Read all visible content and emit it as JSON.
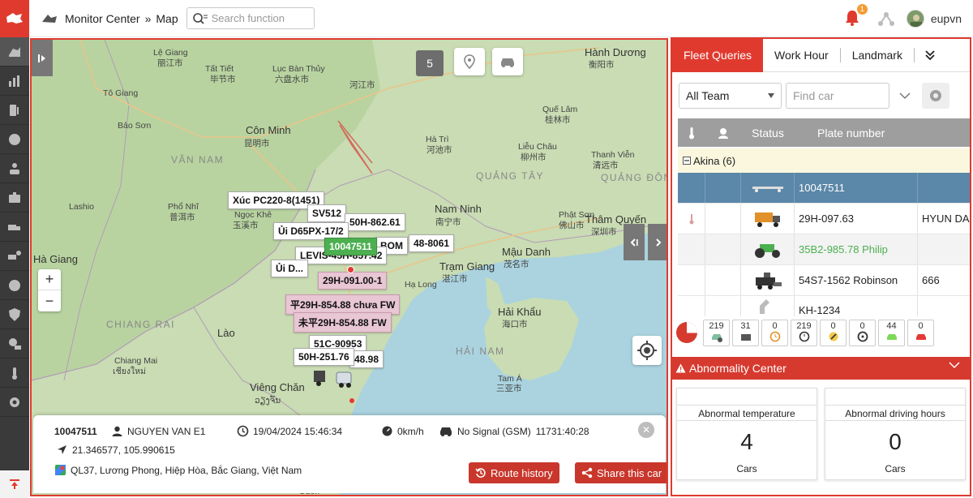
{
  "header": {
    "breadcrumb_section": "Monitor Center",
    "breadcrumb_sep": "»",
    "breadcrumb_page": "Map",
    "search_placeholder": "Search function",
    "notification_count": "1",
    "username": "eupvn"
  },
  "map": {
    "cluster_count": "5",
    "zoom_in": "+",
    "zoom_out": "−",
    "places": [
      {
        "text": "Hà Giang",
        "cls": "big"
      },
      {
        "text": "河江市",
        "cls": ""
      },
      {
        "text": "Hành Dương",
        "cls": "big"
      },
      {
        "text": "衡阳市",
        "cls": ""
      },
      {
        "text": "Lệ Giang",
        "cls": ""
      },
      {
        "text": "丽江市",
        "cls": ""
      },
      {
        "text": "Tất Tiết",
        "cls": ""
      },
      {
        "text": "毕节市",
        "cls": ""
      },
      {
        "text": "Lục Bàn Thủy",
        "cls": ""
      },
      {
        "text": "六盘水市",
        "cls": ""
      },
      {
        "text": "Côn Minh",
        "cls": "big"
      },
      {
        "text": "昆明市",
        "cls": ""
      },
      {
        "text": "VÂN NAM",
        "cls": "region"
      },
      {
        "text": "QUẢNG TÂY",
        "cls": "region"
      },
      {
        "text": "QUẢNG ĐÔNG",
        "cls": "region"
      },
      {
        "text": "Nam Ninh",
        "cls": "big"
      },
      {
        "text": "南宁市",
        "cls": ""
      },
      {
        "text": "Thâm Quyến",
        "cls": "big"
      },
      {
        "text": "深圳市",
        "cls": ""
      },
      {
        "text": "Mậu Danh",
        "cls": "big"
      },
      {
        "text": "茂名市",
        "cls": ""
      },
      {
        "text": "Trạm Giang",
        "cls": "big"
      },
      {
        "text": "湛江市",
        "cls": ""
      },
      {
        "text": "Hải Khẩu",
        "cls": "big"
      },
      {
        "text": "海口市",
        "cls": ""
      },
      {
        "text": "HẢI NAM",
        "cls": "region"
      },
      {
        "text": "Tam Á",
        "cls": ""
      },
      {
        "text": "三亚市",
        "cls": ""
      },
      {
        "text": "Lào",
        "cls": "big"
      },
      {
        "text": "Viêng Chăn",
        "cls": "big"
      },
      {
        "text": "ວຽງຈັນ",
        "cls": ""
      },
      {
        "text": "CHIANG RAI",
        "cls": "region"
      },
      {
        "text": "Chiang Mai",
        "cls": ""
      },
      {
        "text": "เชียงใหม่",
        "cls": ""
      },
      {
        "text": "Lashio",
        "cls": ""
      },
      {
        "text": "Tô Giang",
        "cls": ""
      },
      {
        "text": "Bảo Sơn",
        "cls": ""
      },
      {
        "text": "Liễu Châu",
        "cls": ""
      },
      {
        "text": "柳州市",
        "cls": ""
      },
      {
        "text": "Quế Lâm",
        "cls": ""
      },
      {
        "text": "桂林市",
        "cls": ""
      },
      {
        "text": "Hà Trì",
        "cls": ""
      },
      {
        "text": "河池市",
        "cls": ""
      },
      {
        "text": "Ngọc Khê",
        "cls": ""
      },
      {
        "text": "玉溪市",
        "cls": ""
      },
      {
        "text": "Phổ Nhĩ",
        "cls": ""
      },
      {
        "text": "普洱市",
        "cls": ""
      },
      {
        "text": "Thanh Viễn",
        "cls": ""
      },
      {
        "text": "清远市",
        "cls": ""
      },
      {
        "text": "Phật Sơn",
        "cls": ""
      },
      {
        "text": "佛山市",
        "cls": ""
      },
      {
        "text": "Hạ Long",
        "cls": ""
      },
      {
        "text": "Udon",
        "cls": ""
      }
    ],
    "vehicle_labels": [
      {
        "text": "Xúc PC220-8(1451)",
        "cls": ""
      },
      {
        "text": "SV512",
        "cls": ""
      },
      {
        "text": "50H-862.61",
        "cls": ""
      },
      {
        "text": "Ủi D65PX-17/2",
        "cls": ""
      },
      {
        "text": "BOM",
        "cls": ""
      },
      {
        "text": "48-8061",
        "cls": ""
      },
      {
        "text": "10047511",
        "cls": "green"
      },
      {
        "text": "LEVIS-45H-857.42",
        "cls": ""
      },
      {
        "text": "Ủi D...",
        "cls": ""
      },
      {
        "text": "29H-091.00-1",
        "cls": "pink"
      },
      {
        "text": "平29H-854.88 chưa FW",
        "cls": "pink"
      },
      {
        "text": "未平29H-854.88 FW",
        "cls": "pink"
      },
      {
        "text": "51C-90953",
        "cls": ""
      },
      {
        "text": "50H-251.76",
        "cls": ""
      },
      {
        "text": "48.98",
        "cls": ""
      }
    ],
    "info": {
      "plate": "10047511",
      "driver": "NGUYEN VAN E1",
      "datetime": "19/04/2024 15:46:34",
      "speed": "0km/h",
      "signal": "No Signal (GSM)",
      "duration": "11731:40:28",
      "coords": "21.346577, 105.990615",
      "address": "QL37, Lương Phong, Hiệp Hòa, Bắc Giang, Việt Nam",
      "route_btn": "Route history",
      "share_btn": "Share this car"
    }
  },
  "panel": {
    "tabs": [
      "Fleet Queries",
      "Work Hour",
      "Landmark"
    ],
    "team_select": "All Team",
    "find_placeholder": "Find car",
    "col_status": "Status",
    "col_plate": "Plate number",
    "group": "Akina (6)",
    "rows": [
      {
        "plate": "10047511",
        "extra": "",
        "cls": "selected",
        "temp": false,
        "color": ""
      },
      {
        "plate": "29H-097.63",
        "extra": "HYUN DAI",
        "cls": "",
        "temp": true,
        "color": ""
      },
      {
        "plate": "35B2-985.78 Philip",
        "extra": "",
        "cls": "gray",
        "temp": false,
        "color": "#4caf50"
      },
      {
        "plate": "54S7-1562 Robinson",
        "extra": "666",
        "cls": "",
        "temp": false,
        "color": ""
      },
      {
        "plate": "KH-1234",
        "extra": "",
        "cls": "",
        "temp": false,
        "color": ""
      }
    ],
    "stats": [
      "219",
      "31",
      "0",
      "219",
      "0",
      "0",
      "44",
      "0"
    ],
    "abnormality_title": "Abnormality Center",
    "cards": [
      {
        "title": "Abnormal temperature",
        "value": "4",
        "unit": "Cars"
      },
      {
        "title": "Abnormal driving hours",
        "value": "0",
        "unit": "Cars"
      }
    ]
  }
}
